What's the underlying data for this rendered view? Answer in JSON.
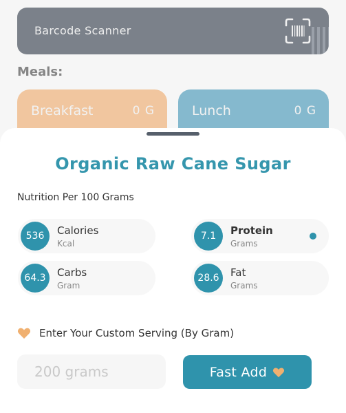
{
  "background": {
    "scanner": {
      "label": "Barcode Scanner",
      "icon": "barcode-scan-icon"
    },
    "meals_label": "Meals:",
    "meals": [
      {
        "name": "Breakfast",
        "value": "0 G",
        "color": "#e8a465"
      },
      {
        "name": "Lunch",
        "value": "0 G",
        "color": "#3b8fb0"
      }
    ]
  },
  "sheet": {
    "title": "Organic Raw Cane Sugar",
    "per_label": "Nutrition Per 100 Grams",
    "nutrients": {
      "calories": {
        "value": "536",
        "label": "Calories",
        "unit": "Kcal"
      },
      "protein": {
        "value": "7.1",
        "label": "Protein",
        "unit": "Grams"
      },
      "carbs": {
        "value": "64.3",
        "label": "Carbs",
        "unit": "Gram"
      },
      "fat": {
        "value": "28.6",
        "label": "Fat",
        "unit": "Grams"
      }
    },
    "custom_serving_label": "Enter Your Custom Serving (By Gram)",
    "serving_input": {
      "placeholder": "200 grams",
      "value": ""
    },
    "fast_add_label": "Fast Add"
  },
  "colors": {
    "accent": "#2f93ac",
    "title": "#3596ad",
    "heart": "#f0b070"
  }
}
